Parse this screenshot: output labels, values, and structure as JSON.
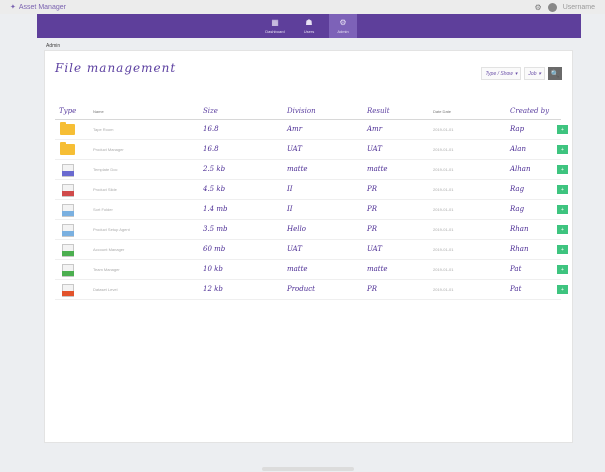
{
  "app": {
    "brand": "Asset Manager",
    "user": "Username"
  },
  "nav": [
    {
      "label": "Dashboard",
      "icon": "dashboard-icon",
      "glyph": "▦",
      "active": false
    },
    {
      "label": "Users",
      "icon": "users-icon",
      "glyph": "☗",
      "active": false
    },
    {
      "label": "Admin",
      "icon": "admin-icon",
      "glyph": "⚙",
      "active": true
    }
  ],
  "breadcrumb": "Admin",
  "page": {
    "title": "File management"
  },
  "filters": {
    "type": "Type / Show",
    "sort": "Job",
    "search_glyph": "🔍"
  },
  "columns": {
    "type": "Type",
    "name": "Name",
    "size": "Size",
    "division": "Division",
    "result": "Result",
    "date": "Date Date",
    "created_by": "Created by"
  },
  "rows": [
    {
      "kind": "folder",
      "name": "Tape Room",
      "size": "16.8",
      "division": "Amr",
      "result": "Amr",
      "date": "2019-01-01",
      "created_by": "Rap",
      "action": "+"
    },
    {
      "kind": "folder",
      "name": "Product Manager",
      "size": "16.8",
      "division": "UAT",
      "result": "UAT",
      "date": "2019-01-01",
      "created_by": "Alan",
      "action": "+"
    },
    {
      "kind": "doc",
      "band": "#6a6ad0",
      "name": "Template Doc",
      "size": "2.5 kb",
      "division": "matte",
      "result": "matte",
      "date": "2019-01-01",
      "created_by": "Alhan",
      "action": "+"
    },
    {
      "kind": "doc",
      "band": "#d04a4a",
      "name": "Product Slide",
      "size": "4.5 kb",
      "division": "II",
      "result": "PR",
      "date": "2019-01-01",
      "created_by": "Rag",
      "action": "+"
    },
    {
      "kind": "doc",
      "band": "#7ab0e0",
      "name": "Sort Folder",
      "size": "1.4 mb",
      "division": "II",
      "result": "PR",
      "date": "2019-01-01",
      "created_by": "Rag",
      "action": "+"
    },
    {
      "kind": "doc",
      "band": "#7ab0e0",
      "name": "Product Setup Agent",
      "size": "3.5 mb",
      "division": "Hello",
      "result": "PR",
      "date": "2019-01-01",
      "created_by": "Rhan",
      "action": "+"
    },
    {
      "kind": "doc",
      "band": "#4caf50",
      "name": "Account Manager",
      "size": "60 mb",
      "division": "UAT",
      "result": "UAT",
      "date": "2019-01-01",
      "created_by": "Rhan",
      "action": "+"
    },
    {
      "kind": "doc",
      "band": "#4caf50",
      "name": "Team Manager",
      "size": "10 kb",
      "division": "matte",
      "result": "matte",
      "date": "2019-01-01",
      "created_by": "Pat",
      "action": "+"
    },
    {
      "kind": "doc",
      "band": "#e2532c",
      "name": "Dataset Level",
      "size": "12 kb",
      "division": "Product",
      "result": "PR",
      "date": "2019-01-01",
      "created_by": "Pat",
      "action": "+"
    }
  ]
}
